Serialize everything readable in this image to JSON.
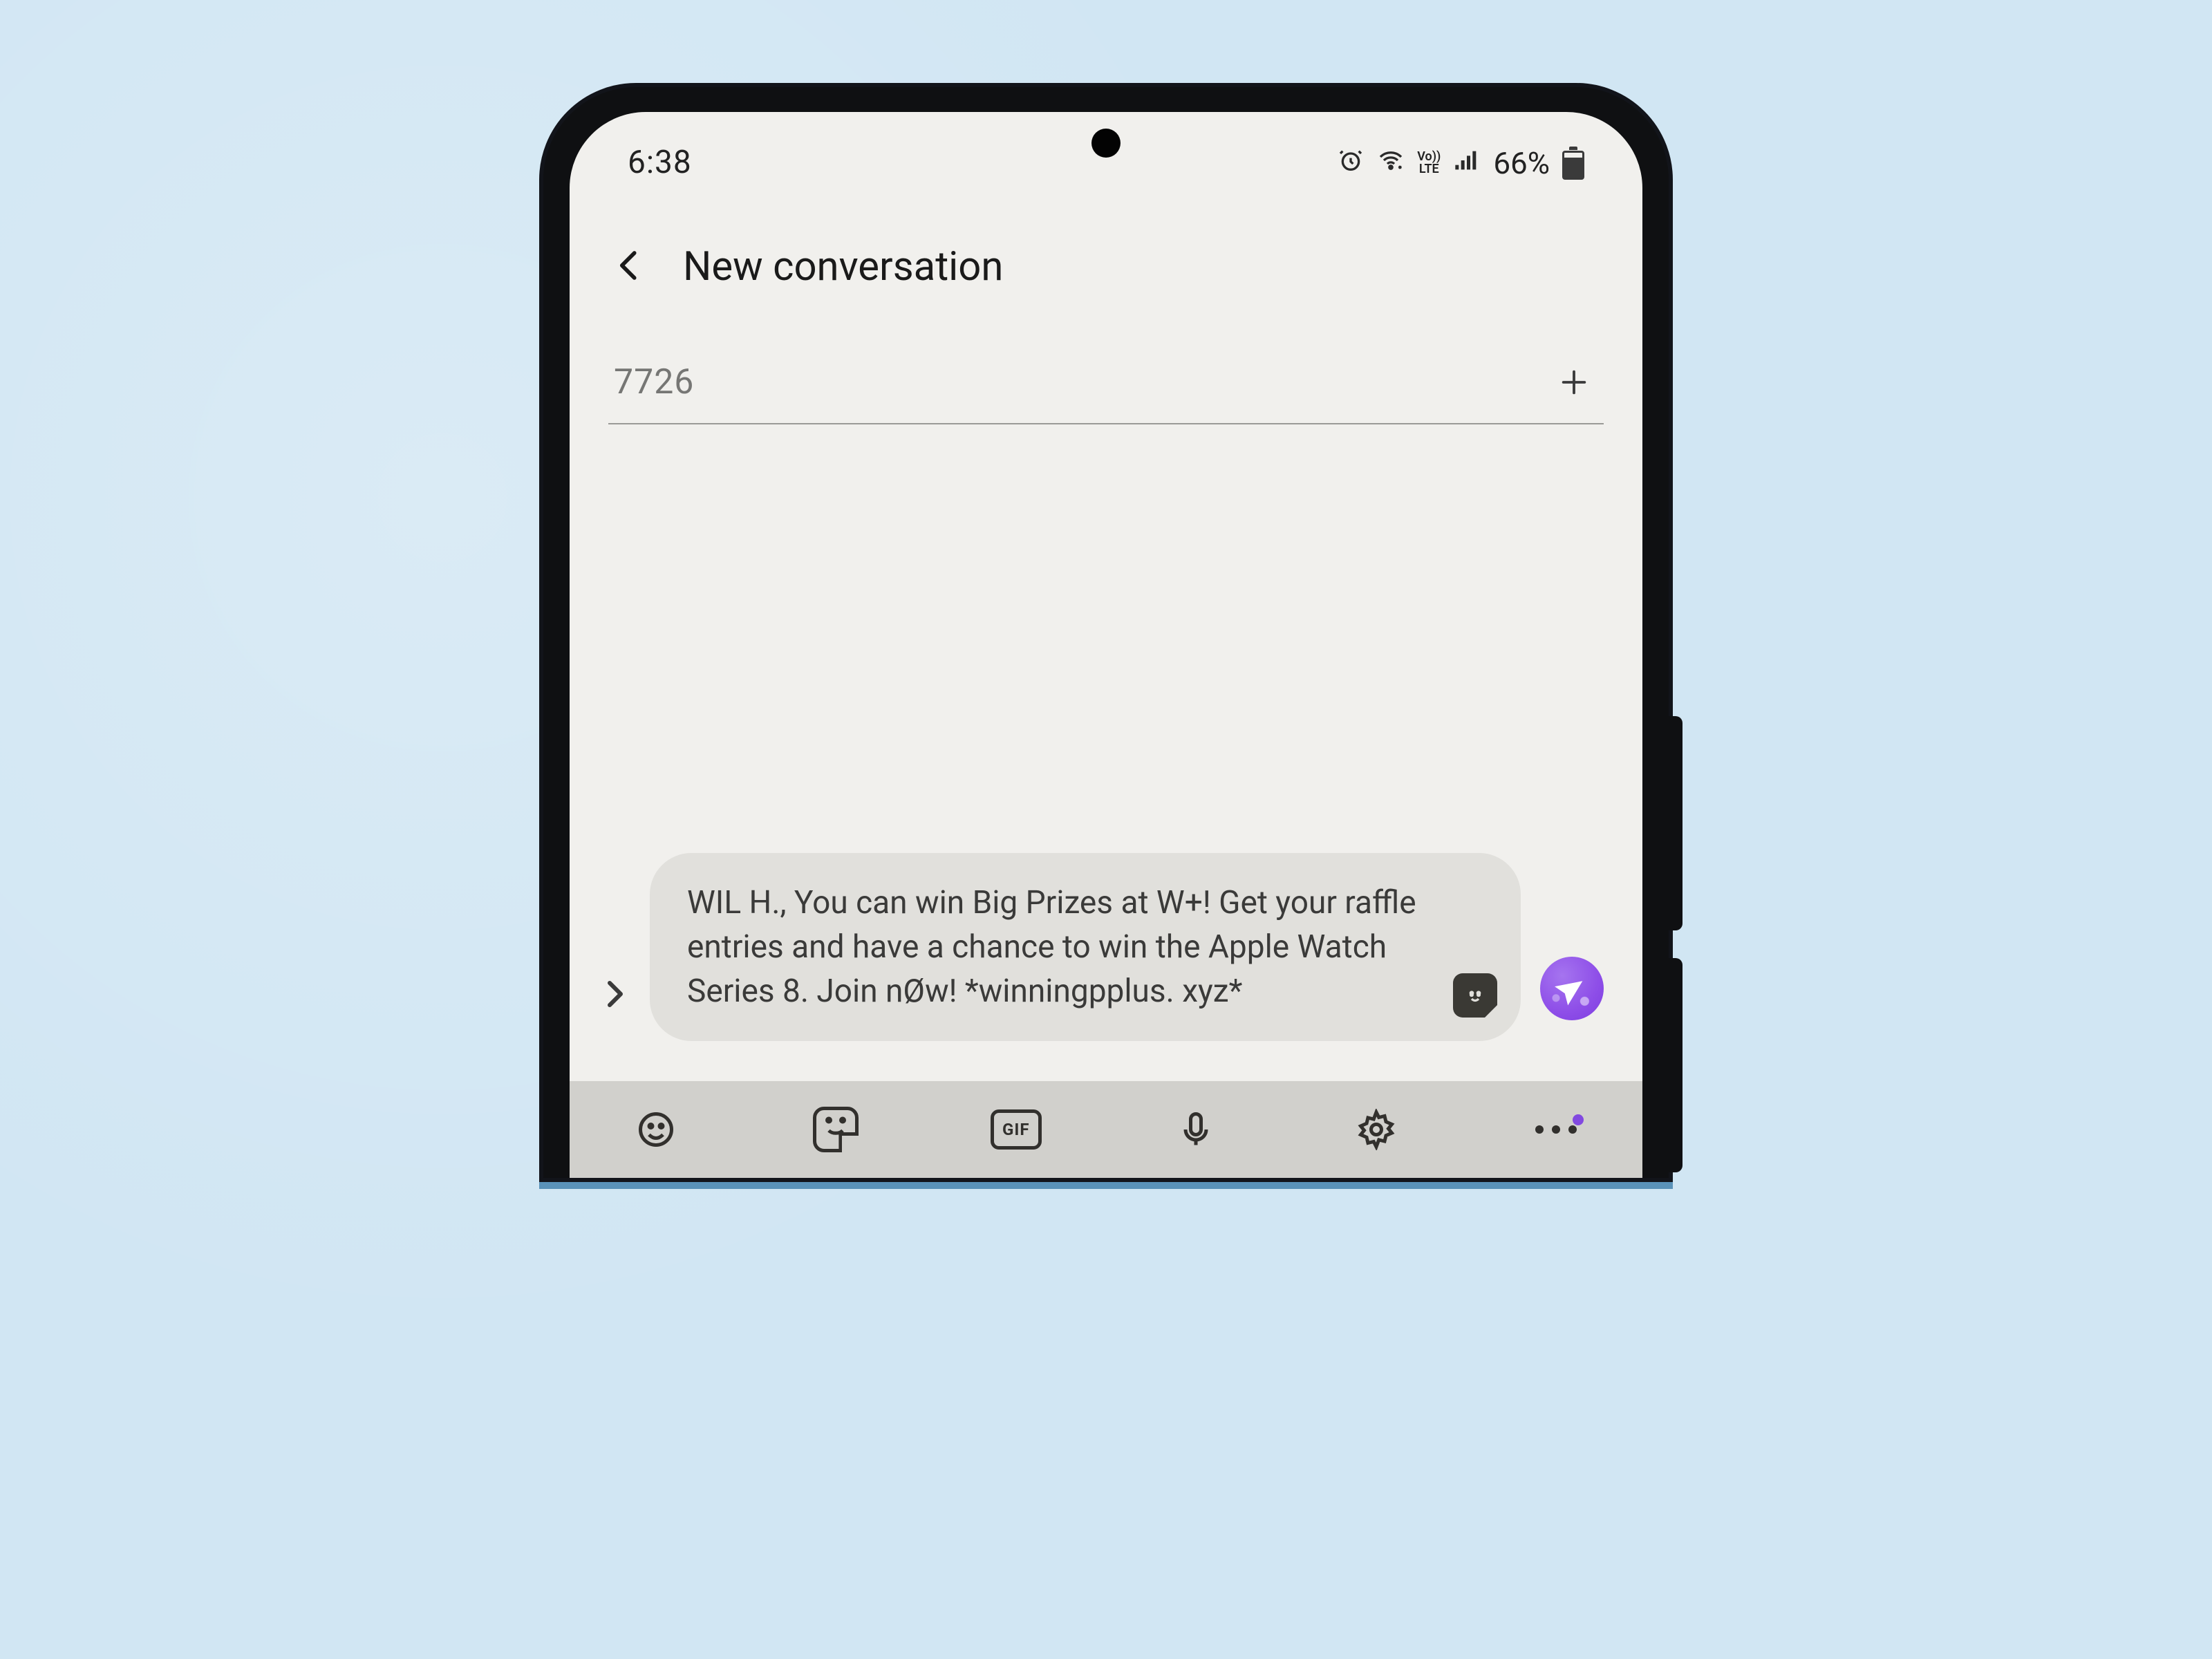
{
  "status": {
    "time": "6:38",
    "battery_percent": "66%",
    "volte_top": "Vo))",
    "volte_bottom": "LTE"
  },
  "header": {
    "title": "New conversation"
  },
  "recipient": {
    "value": "7726"
  },
  "message": {
    "text": "WIL H., You can win Big Prizes at W+! Get your raffle entries and have a chance to win the Apple Watch Series 8. Join nØw! *winningpplus. xyz*"
  },
  "keyboard": {
    "gif_label": "GIF"
  }
}
